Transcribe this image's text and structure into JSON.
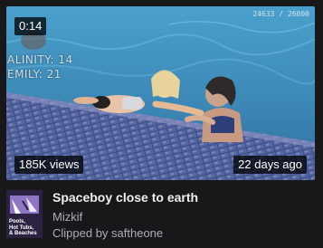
{
  "clip": {
    "duration": "0:14",
    "views": "185K views",
    "age": "22 days ago",
    "title": "Spaceboy close to earth",
    "channel": "Mizkif",
    "clipped_by": "Clipped by saftheone"
  },
  "video_overlay": {
    "line1": "ALINITY: 14",
    "line2": "EMILY: 21",
    "counter": "24633 / 26000"
  },
  "category": {
    "name": "Pools, Hot Tubs, & Beaches",
    "line1": "Pools,",
    "line2": "Hot Tubs,",
    "line3": "& Beaches"
  },
  "colors": {
    "background": "#18181b",
    "title": "#efeff1",
    "secondary_text": "#adadb8",
    "badge_bg": "rgba(0,0,0,0.75)",
    "pool_water": "#3f8fbe"
  }
}
